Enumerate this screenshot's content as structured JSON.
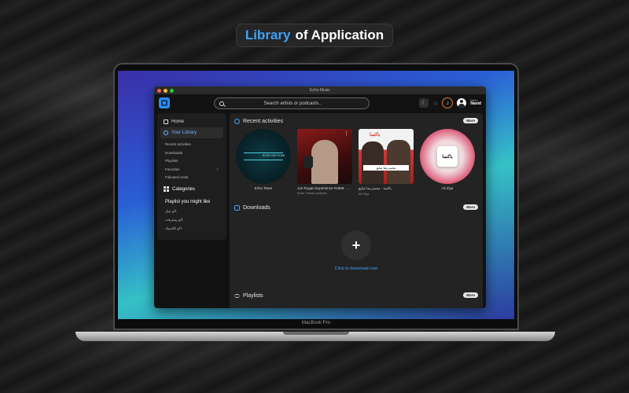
{
  "headline": {
    "accent": "Library",
    "rest": "of Application"
  },
  "device": {
    "model": "MacBook Pro"
  },
  "app": {
    "window_title": "Echo Music",
    "search_placeholder": "Search artists or podcasts..",
    "user": {
      "greeting": "Hello",
      "name": "Navid"
    },
    "sidebar": {
      "home": "Home",
      "library": "Your Library",
      "library_items": [
        "Recent activities",
        "Downloads",
        "Playlists",
        "Favorites",
        "Followed Artist"
      ],
      "categories": "Categories",
      "playlists_heading": "Playlist you might like",
      "playlists": [
        "اکو چیل",
        "اکو پیشرفت",
        "اکو کلاسیک"
      ]
    },
    "sections": {
      "recent": "Recent activities",
      "downloads": "Downloads",
      "playlists": "Playlists",
      "more": "More"
    },
    "recent_items": [
      {
        "title": "Echo Team",
        "subtitle": ""
      },
      {
        "title": "Joe Rogan Experience #1869 - St...",
        "subtitle": "Echo Trends podcast"
      },
      {
        "title": "باکسا - محمدرضا شایع",
        "subtitle": "Ali Ziya"
      },
      {
        "title": "Ali Ziya",
        "subtitle": ""
      }
    ],
    "thumb_text": {
      "echo": "ECHO DEVTEAM",
      "brand": "باکسا",
      "band": "محمدرضا شایع",
      "brand_box": "باکسا"
    },
    "downloads_cta": "Click to download now"
  },
  "colors": {
    "accent": "#3fa2f7",
    "window_bg": "#121212",
    "panel_bg": "#232323"
  }
}
